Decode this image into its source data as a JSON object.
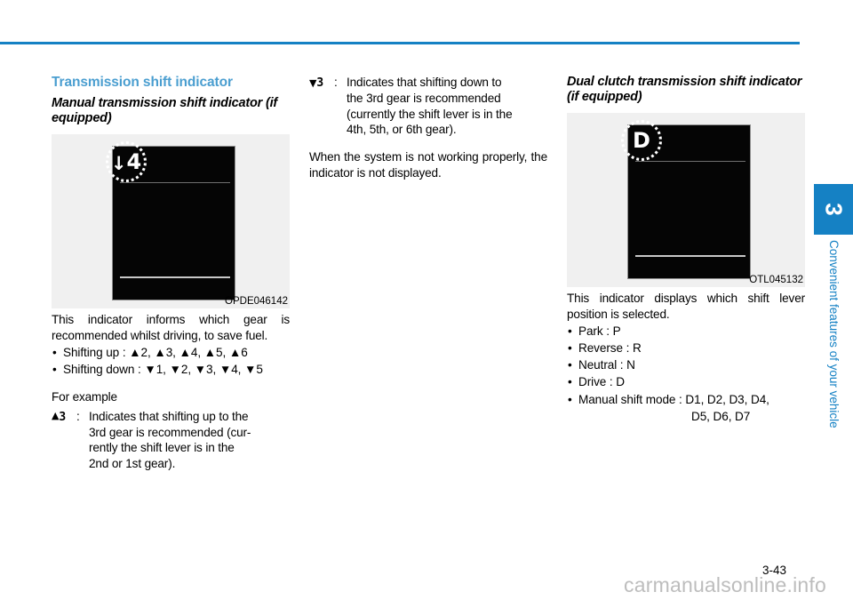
{
  "page": {
    "number": "3-43",
    "watermark": "carmanualsonline.info",
    "accent_color": "#1581c4",
    "heading_color": "#4a9ed0"
  },
  "side_tab": {
    "chapter_number": "3",
    "chapter_title": "Convenient features of your vehicle"
  },
  "column1": {
    "section_title": "Transmission shift indicator",
    "sub_title": "Manual transmission shift indicator (if equipped)",
    "figure": {
      "caption": "OPDE046142",
      "badge_arrow": "↓",
      "badge_gear": "4"
    },
    "intro": "This indicator informs which gear is recommended whilst driving, to save fuel.",
    "bullets": [
      {
        "label": "Shifting up :",
        "arrow": "▲",
        "values": "2, 3, 4, 5, 6",
        "rendered": "Shifting up : ▲2, ▲3, ▲4, ▲5, ▲6"
      },
      {
        "label": "Shifting down :",
        "arrow": "▼",
        "values": "1, 2, 3, 4, 5",
        "rendered": "Shifting down : ▼1, ▼2, ▼3, ▼4, ▼5"
      }
    ],
    "example_heading": "For example",
    "example": {
      "marker_arrow": "▲",
      "marker_gear": "3",
      "colon": ":",
      "line1": "Indicates that shifting up to the",
      "line2": "3rd gear is recommended (cur-",
      "line3": "rently the shift lever is in the",
      "line4": "2nd or 1st gear)."
    }
  },
  "column2": {
    "example": {
      "marker_arrow": "▼",
      "marker_gear": "3",
      "colon": ":",
      "line1": "Indicates that shifting down to",
      "line2": "the 3rd gear is recommended",
      "line3": "(currently the shift lever is in the",
      "line4": "4th, 5th, or 6th gear)."
    },
    "note": "When the system is not working properly, the indicator is not displayed."
  },
  "column3": {
    "sub_title": "Dual clutch transmission shift indicator (if equipped)",
    "figure": {
      "caption": "OTL045132",
      "badge_gear": "D"
    },
    "intro": "This indicator displays which shift lever position is selected.",
    "bullets": [
      {
        "rendered": "Park : P"
      },
      {
        "rendered": "Reverse : R"
      },
      {
        "rendered": "Neutral : N"
      },
      {
        "rendered": "Drive : D"
      },
      {
        "rendered": "Manual shift mode : D1, D2, D3, D4,"
      },
      {
        "rendered": "D5, D6, D7",
        "continuation": true
      }
    ]
  }
}
